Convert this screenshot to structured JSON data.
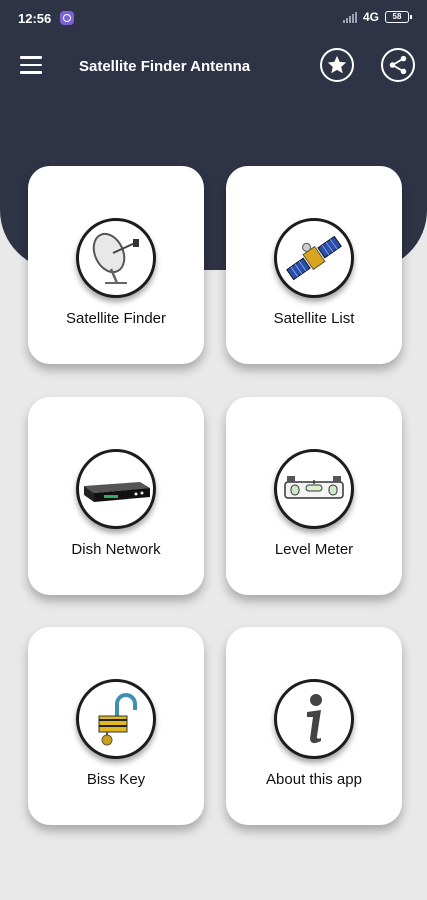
{
  "status_bar": {
    "time": "12:56",
    "network": "4G",
    "battery": "58"
  },
  "toolbar": {
    "title": "Satellite Finder Antenna",
    "menu_icon": "hamburger-menu-icon",
    "star_icon": "star-icon",
    "share_icon": "share-icon"
  },
  "cards": [
    {
      "label": "Satellite Finder",
      "icon": "satellite-dish-icon"
    },
    {
      "label": "Satellite List",
      "icon": "satellite-icon"
    },
    {
      "label": "Dish Network",
      "icon": "receiver-box-icon"
    },
    {
      "label": "Level Meter",
      "icon": "spirit-level-icon"
    },
    {
      "label": "Biss Key",
      "icon": "padlock-key-icon"
    },
    {
      "label": "About this app",
      "icon": "info-icon"
    }
  ],
  "colors": {
    "header": "#2e3446",
    "background": "#e9e9e9",
    "card": "#ffffff"
  }
}
